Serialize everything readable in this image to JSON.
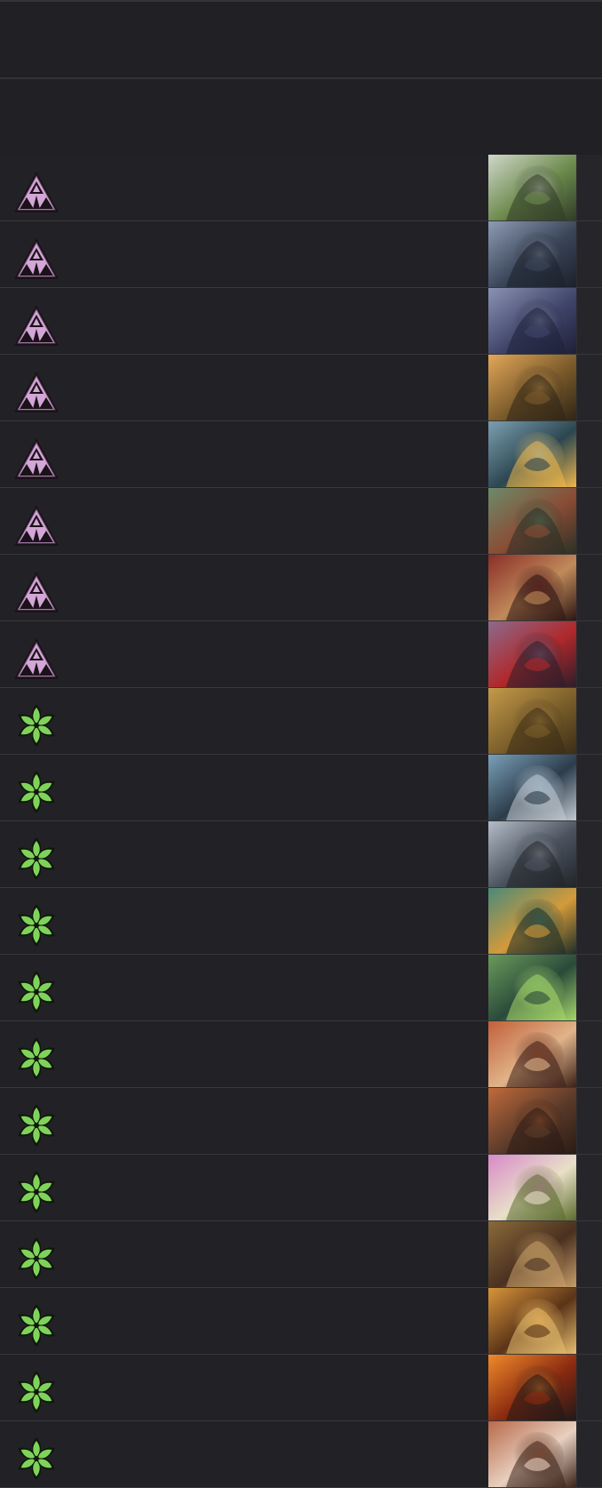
{
  "header": {
    "bar1": "",
    "bar2": ""
  },
  "colors": {
    "background": "#202024",
    "row": "#222226",
    "divider": "#38383c",
    "faction_purple": "#d4a6d8",
    "faction_green": "#7fd35a"
  },
  "rows": [
    {
      "faction": "purple-triangle-icon",
      "art": "swamp-troll-art",
      "palette": [
        "#cfd7c9",
        "#6c8a4c",
        "#2f3b27"
      ]
    },
    {
      "faction": "purple-triangle-icon",
      "art": "crocodile-beast-art",
      "palette": [
        "#8d9bb4",
        "#3a4558",
        "#1c212b"
      ]
    },
    {
      "faction": "purple-triangle-icon",
      "art": "cloaked-figure-art",
      "palette": [
        "#8a92b4",
        "#40456a",
        "#1e2038"
      ]
    },
    {
      "faction": "purple-triangle-icon",
      "art": "goblin-spearman-art",
      "palette": [
        "#e3a75a",
        "#7a5a2a",
        "#2e2416"
      ]
    },
    {
      "faction": "purple-triangle-icon",
      "art": "hooded-mage-art",
      "palette": [
        "#7b9fb0",
        "#2c4650",
        "#f0b84a"
      ]
    },
    {
      "faction": "purple-triangle-icon",
      "art": "forest-brute-art",
      "palette": [
        "#6c8a6a",
        "#8a4c34",
        "#2a3026"
      ]
    },
    {
      "faction": "purple-triangle-icon",
      "art": "ratman-art",
      "palette": [
        "#8a2e28",
        "#c08a5a",
        "#2a1412"
      ]
    },
    {
      "faction": "purple-triangle-icon",
      "art": "bloodfly-art",
      "palette": [
        "#8c6a8c",
        "#b0282a",
        "#2a1e2a"
      ]
    },
    {
      "faction": "green-leaf-icon",
      "art": "stone-idol-art",
      "palette": [
        "#c49a4a",
        "#7a5e2a",
        "#3a2c16"
      ]
    },
    {
      "faction": "green-leaf-icon",
      "art": "hooded-archer-art",
      "palette": [
        "#7aa0b8",
        "#2c3c4a",
        "#c4ccd4"
      ]
    },
    {
      "faction": "green-leaf-icon",
      "art": "armored-knight-art",
      "palette": [
        "#b4bcc8",
        "#4a525e",
        "#202428"
      ]
    },
    {
      "faction": "green-leaf-icon",
      "art": "fox-warriors-art",
      "palette": [
        "#4a8a7a",
        "#d49a3a",
        "#1c2e28"
      ]
    },
    {
      "faction": "green-leaf-icon",
      "art": "forest-spirit-art",
      "palette": [
        "#6a9a5a",
        "#2a4a3a",
        "#a8d86a"
      ]
    },
    {
      "faction": "green-leaf-icon",
      "art": "red-haired-warrior-art",
      "palette": [
        "#c2603a",
        "#e0b48a",
        "#3a1e16"
      ]
    },
    {
      "faction": "green-leaf-icon",
      "art": "axe-dwarf-art",
      "palette": [
        "#c06a3a",
        "#5a3a2a",
        "#2a1a14"
      ]
    },
    {
      "faction": "green-leaf-icon",
      "art": "flower-skull-art",
      "palette": [
        "#d88ac8",
        "#e8e0c8",
        "#5a6a2a"
      ]
    },
    {
      "faction": "green-leaf-icon",
      "art": "bear-cubs-art",
      "palette": [
        "#8a6a3a",
        "#4a3020",
        "#c8a06a"
      ]
    },
    {
      "faction": "green-leaf-icon",
      "art": "great-bear-art",
      "palette": [
        "#d8943a",
        "#5a3418",
        "#e8c070"
      ]
    },
    {
      "faction": "green-leaf-icon",
      "art": "lava-field-art",
      "palette": [
        "#f08a2a",
        "#8a2a10",
        "#201818"
      ]
    },
    {
      "faction": "green-leaf-icon",
      "art": "maiden-portrait-art",
      "palette": [
        "#b86a4a",
        "#e8d0c0",
        "#3a2218"
      ]
    }
  ]
}
